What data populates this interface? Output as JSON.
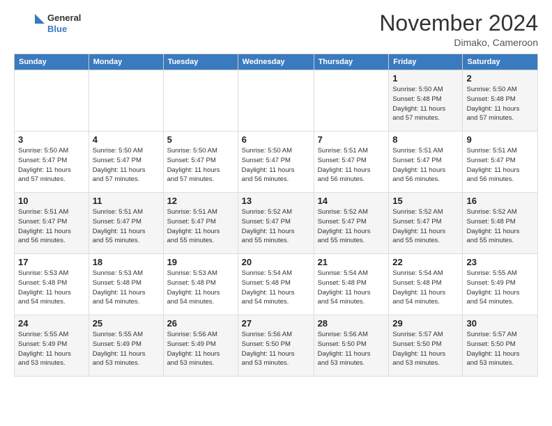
{
  "header": {
    "logo_line1": "General",
    "logo_line2": "Blue",
    "month_title": "November 2024",
    "location": "Dimako, Cameroon"
  },
  "weekdays": [
    "Sunday",
    "Monday",
    "Tuesday",
    "Wednesday",
    "Thursday",
    "Friday",
    "Saturday"
  ],
  "weeks": [
    [
      {
        "day": "",
        "info": ""
      },
      {
        "day": "",
        "info": ""
      },
      {
        "day": "",
        "info": ""
      },
      {
        "day": "",
        "info": ""
      },
      {
        "day": "",
        "info": ""
      },
      {
        "day": "1",
        "info": "Sunrise: 5:50 AM\nSunset: 5:48 PM\nDaylight: 11 hours\nand 57 minutes."
      },
      {
        "day": "2",
        "info": "Sunrise: 5:50 AM\nSunset: 5:48 PM\nDaylight: 11 hours\nand 57 minutes."
      }
    ],
    [
      {
        "day": "3",
        "info": "Sunrise: 5:50 AM\nSunset: 5:47 PM\nDaylight: 11 hours\nand 57 minutes."
      },
      {
        "day": "4",
        "info": "Sunrise: 5:50 AM\nSunset: 5:47 PM\nDaylight: 11 hours\nand 57 minutes."
      },
      {
        "day": "5",
        "info": "Sunrise: 5:50 AM\nSunset: 5:47 PM\nDaylight: 11 hours\nand 57 minutes."
      },
      {
        "day": "6",
        "info": "Sunrise: 5:50 AM\nSunset: 5:47 PM\nDaylight: 11 hours\nand 56 minutes."
      },
      {
        "day": "7",
        "info": "Sunrise: 5:51 AM\nSunset: 5:47 PM\nDaylight: 11 hours\nand 56 minutes."
      },
      {
        "day": "8",
        "info": "Sunrise: 5:51 AM\nSunset: 5:47 PM\nDaylight: 11 hours\nand 56 minutes."
      },
      {
        "day": "9",
        "info": "Sunrise: 5:51 AM\nSunset: 5:47 PM\nDaylight: 11 hours\nand 56 minutes."
      }
    ],
    [
      {
        "day": "10",
        "info": "Sunrise: 5:51 AM\nSunset: 5:47 PM\nDaylight: 11 hours\nand 56 minutes."
      },
      {
        "day": "11",
        "info": "Sunrise: 5:51 AM\nSunset: 5:47 PM\nDaylight: 11 hours\nand 55 minutes."
      },
      {
        "day": "12",
        "info": "Sunrise: 5:51 AM\nSunset: 5:47 PM\nDaylight: 11 hours\nand 55 minutes."
      },
      {
        "day": "13",
        "info": "Sunrise: 5:52 AM\nSunset: 5:47 PM\nDaylight: 11 hours\nand 55 minutes."
      },
      {
        "day": "14",
        "info": "Sunrise: 5:52 AM\nSunset: 5:47 PM\nDaylight: 11 hours\nand 55 minutes."
      },
      {
        "day": "15",
        "info": "Sunrise: 5:52 AM\nSunset: 5:47 PM\nDaylight: 11 hours\nand 55 minutes."
      },
      {
        "day": "16",
        "info": "Sunrise: 5:52 AM\nSunset: 5:48 PM\nDaylight: 11 hours\nand 55 minutes."
      }
    ],
    [
      {
        "day": "17",
        "info": "Sunrise: 5:53 AM\nSunset: 5:48 PM\nDaylight: 11 hours\nand 54 minutes."
      },
      {
        "day": "18",
        "info": "Sunrise: 5:53 AM\nSunset: 5:48 PM\nDaylight: 11 hours\nand 54 minutes."
      },
      {
        "day": "19",
        "info": "Sunrise: 5:53 AM\nSunset: 5:48 PM\nDaylight: 11 hours\nand 54 minutes."
      },
      {
        "day": "20",
        "info": "Sunrise: 5:54 AM\nSunset: 5:48 PM\nDaylight: 11 hours\nand 54 minutes."
      },
      {
        "day": "21",
        "info": "Sunrise: 5:54 AM\nSunset: 5:48 PM\nDaylight: 11 hours\nand 54 minutes."
      },
      {
        "day": "22",
        "info": "Sunrise: 5:54 AM\nSunset: 5:48 PM\nDaylight: 11 hours\nand 54 minutes."
      },
      {
        "day": "23",
        "info": "Sunrise: 5:55 AM\nSunset: 5:49 PM\nDaylight: 11 hours\nand 54 minutes."
      }
    ],
    [
      {
        "day": "24",
        "info": "Sunrise: 5:55 AM\nSunset: 5:49 PM\nDaylight: 11 hours\nand 53 minutes."
      },
      {
        "day": "25",
        "info": "Sunrise: 5:55 AM\nSunset: 5:49 PM\nDaylight: 11 hours\nand 53 minutes."
      },
      {
        "day": "26",
        "info": "Sunrise: 5:56 AM\nSunset: 5:49 PM\nDaylight: 11 hours\nand 53 minutes."
      },
      {
        "day": "27",
        "info": "Sunrise: 5:56 AM\nSunset: 5:50 PM\nDaylight: 11 hours\nand 53 minutes."
      },
      {
        "day": "28",
        "info": "Sunrise: 5:56 AM\nSunset: 5:50 PM\nDaylight: 11 hours\nand 53 minutes."
      },
      {
        "day": "29",
        "info": "Sunrise: 5:57 AM\nSunset: 5:50 PM\nDaylight: 11 hours\nand 53 minutes."
      },
      {
        "day": "30",
        "info": "Sunrise: 5:57 AM\nSunset: 5:50 PM\nDaylight: 11 hours\nand 53 minutes."
      }
    ]
  ]
}
